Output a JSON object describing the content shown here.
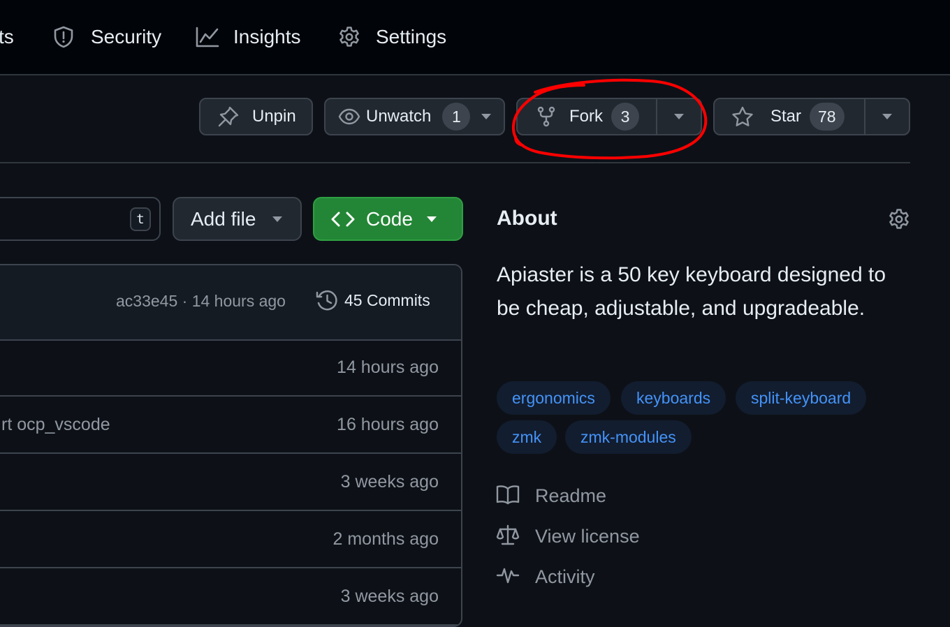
{
  "nav": {
    "items": [
      {
        "label": "ts",
        "icon": "pull-requests-icon"
      },
      {
        "label": "Security",
        "icon": "shield-icon"
      },
      {
        "label": "Insights",
        "icon": "graph-icon"
      },
      {
        "label": "Settings",
        "icon": "gear-icon"
      }
    ]
  },
  "actions": {
    "unpin": {
      "label": "Unpin",
      "icon": "pin-icon"
    },
    "watch": {
      "label": "Unwatch",
      "count": "1",
      "icon": "eye-icon"
    },
    "fork": {
      "label": "Fork",
      "count": "3",
      "icon": "fork-icon"
    },
    "star": {
      "label": "Star",
      "count": "78",
      "icon": "star-icon"
    }
  },
  "annotation": {
    "color": "#ff0000",
    "shape": "red freehand ellipse around Fork button"
  },
  "toolbar": {
    "goto_shortcut": "t",
    "add_file": "Add file",
    "code": "Code"
  },
  "latest_commit": {
    "sha": "ac33e45",
    "separator": "·",
    "time": "14 hours ago",
    "commits": "45 Commits"
  },
  "files": [
    {
      "message": "",
      "date": "14 hours ago"
    },
    {
      "message": "rt ocp_vscode",
      "date": "16 hours ago"
    },
    {
      "message": "",
      "date": "3 weeks ago"
    },
    {
      "message": "",
      "date": "2 months ago"
    },
    {
      "message": "",
      "date": "3 weeks ago"
    }
  ],
  "about": {
    "title": "About",
    "description": "Apiaster is a 50 key keyboard designed to be cheap, adjustable, and upgradeable.",
    "topics": [
      "ergonomics",
      "keyboards",
      "split-keyboard",
      "zmk",
      "zmk-modules"
    ],
    "links": [
      {
        "label": "Readme",
        "icon": "book-icon"
      },
      {
        "label": "View license",
        "icon": "law-icon"
      },
      {
        "label": "Activity",
        "icon": "pulse-icon"
      }
    ]
  },
  "colors": {
    "background": "#0d1117",
    "header": "#010409",
    "button": "#212830",
    "border": "#3d444d",
    "code_green": "#238636",
    "link_blue": "#4493f8",
    "muted": "#9198a1"
  }
}
